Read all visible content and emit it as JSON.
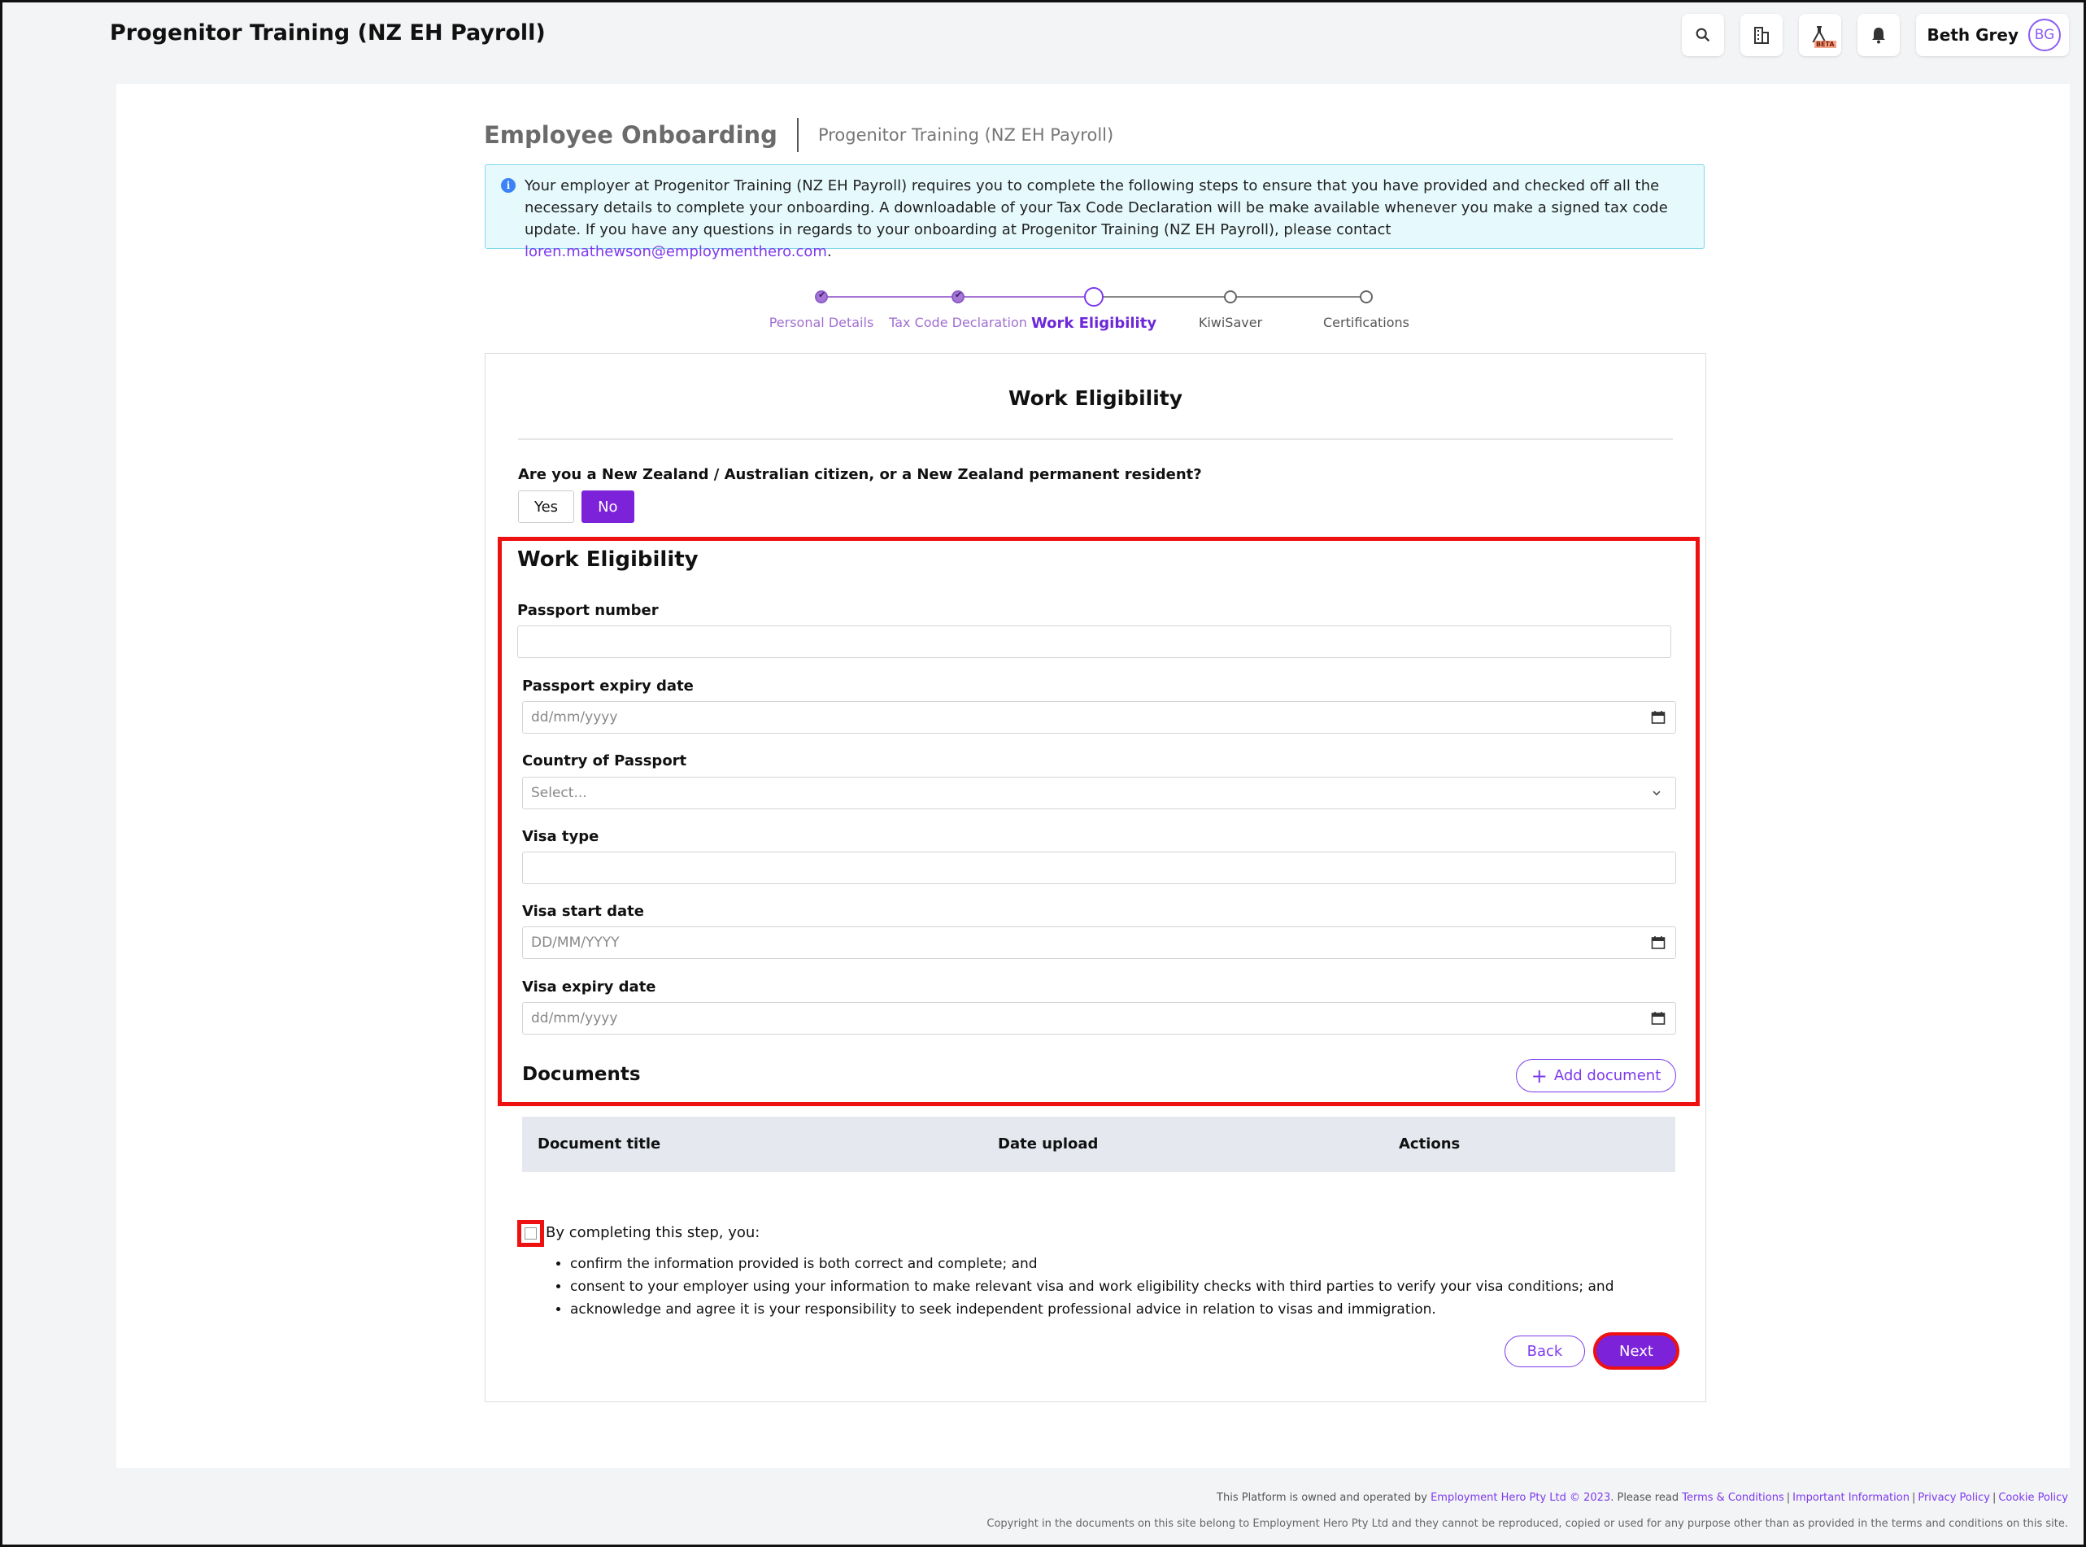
{
  "app": {
    "title": "Progenitor Training (NZ EH Payroll)"
  },
  "topbar": {
    "icons": [
      "search-icon",
      "building-icon",
      "beta-lab-icon",
      "bell-icon"
    ],
    "beta_badge": "BETA",
    "user_name": "Beth Grey",
    "user_initials": "BG"
  },
  "header": {
    "title": "Employee Onboarding",
    "subtitle": "Progenitor Training (NZ EH Payroll)"
  },
  "info": {
    "text": "Your employer at Progenitor Training (NZ EH Payroll) requires you to complete the following steps to ensure that you have provided and checked off all the necessary details to complete your onboarding. A downloadable of your Tax Code Declaration will be make available whenever you make a signed tax code update. If you have any questions in regards to your onboarding at Progenitor Training (NZ EH Payroll), please contact ",
    "email": "loren.mathewson@employmenthero.com",
    "end": "."
  },
  "stepper": {
    "steps": [
      {
        "label": "Personal Details",
        "state": "done"
      },
      {
        "label": "Tax Code Declaration",
        "state": "done"
      },
      {
        "label": "Work Eligibility",
        "state": "current"
      },
      {
        "label": "KiwiSaver",
        "state": "todo"
      },
      {
        "label": "Certifications",
        "state": "todo"
      }
    ]
  },
  "form": {
    "title": "Work Eligibility",
    "question": "Are you a New Zealand / Australian citizen, or a New Zealand permanent resident?",
    "yes_label": "Yes",
    "no_label": "No",
    "selected": "No",
    "section_title": "Work Eligibility",
    "passport_number": {
      "label": "Passport number",
      "value": ""
    },
    "passport_expiry": {
      "label": "Passport expiry date",
      "placeholder": "dd/mm/yyyy"
    },
    "country": {
      "label": "Country of Passport",
      "placeholder": "Select..."
    },
    "visa_type": {
      "label": "Visa type",
      "value": ""
    },
    "visa_start": {
      "label": "Visa start date",
      "placeholder": "DD/MM/YYYY"
    },
    "visa_expiry": {
      "label": "Visa expiry date",
      "placeholder": "dd/mm/yyyy"
    },
    "documents_title": "Documents",
    "add_document": "Add document",
    "doc_columns": [
      "Document title",
      "Date upload",
      "Actions"
    ],
    "consent_intro": "By completing this step, you:",
    "consent_bullets": [
      "confirm the information provided is both correct and complete; and",
      "consent to your employer using your information to make relevant visa and work eligibility checks with third parties to verify your visa conditions; and",
      "acknowledge and agree it is your responsibility to seek independent professional advice in relation to visas and immigration."
    ],
    "back_label": "Back",
    "next_label": "Next"
  },
  "footer": {
    "line1_prefix": "This Platform is owned and operated by ",
    "company_link": "Employment Hero Pty Ltd © 2023",
    "line1_mid": ". Please read ",
    "links": [
      "Terms & Conditions",
      "Important Information",
      "Privacy Policy",
      "Cookie Policy"
    ],
    "line2": "Copyright in the documents on this site belong to Employment Hero Pty Ltd and they cannot be reproduced, copied or used for any purpose other than as provided in the terms and conditions on this site."
  },
  "colors": {
    "accent": "#7c22d9",
    "highlight": "#ee1111",
    "info_bg": "#e6fafd"
  }
}
